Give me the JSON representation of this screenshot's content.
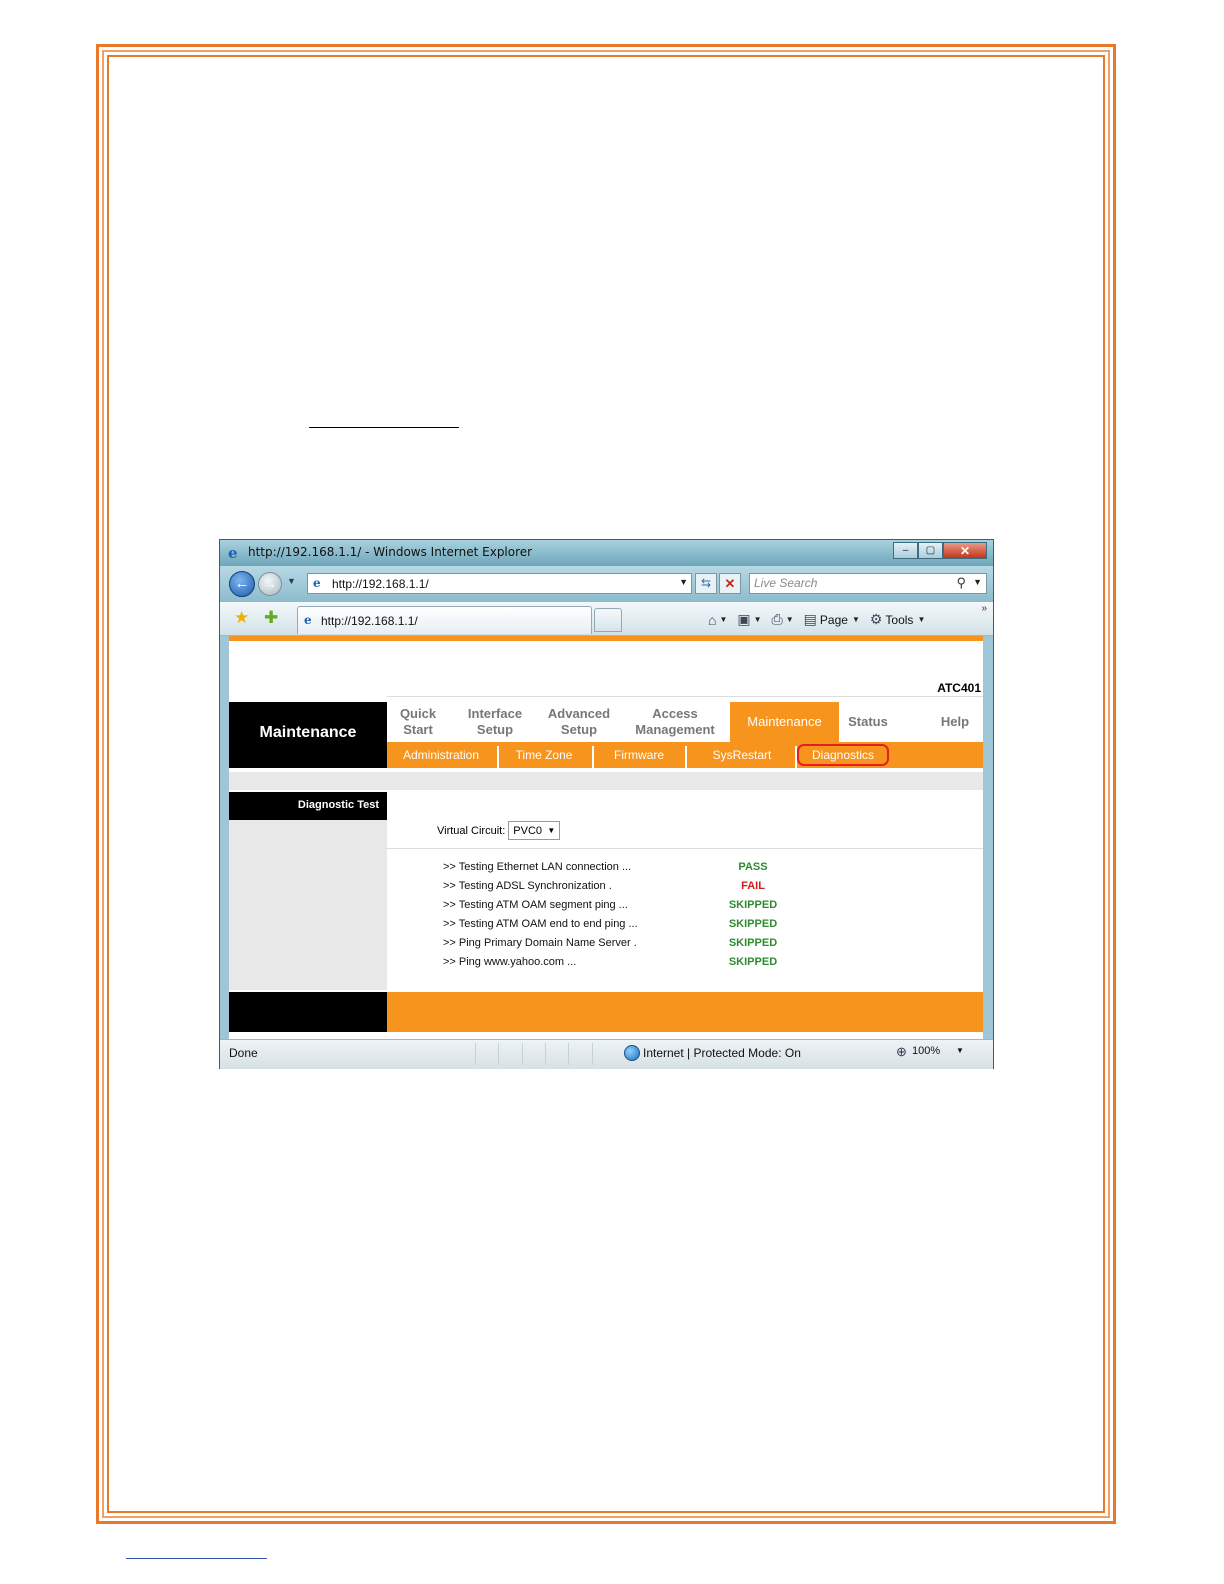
{
  "window": {
    "title": "http://192.168.1.1/ - Windows Internet Explorer",
    "minimize": "–",
    "maximize": "▢",
    "close": "✕"
  },
  "address_bar": {
    "url": "http://192.168.1.1/",
    "search_placeholder": "Live Search"
  },
  "tab": {
    "label": "http://192.168.1.1/"
  },
  "command_bar": {
    "page_label": "Page",
    "tools_label": "Tools"
  },
  "router": {
    "brand": "ATC401",
    "section_title": "Maintenance",
    "menu": [
      {
        "label": "Quick\nStart"
      },
      {
        "label": "Interface\nSetup"
      },
      {
        "label": "Advanced\nSetup"
      },
      {
        "label": "Access\nManagement"
      },
      {
        "label": "Maintenance",
        "active": true
      },
      {
        "label": "Status"
      },
      {
        "label": "Help"
      }
    ],
    "submenu": [
      {
        "label": "Administration"
      },
      {
        "label": "Time Zone"
      },
      {
        "label": "Firmware"
      },
      {
        "label": "SysRestart"
      },
      {
        "label": "Diagnostics",
        "selected": true
      }
    ],
    "sidebar_label": "Diagnostic Test",
    "virtual_circuit": {
      "label": "Virtual Circuit:",
      "value": "PVC0"
    },
    "tests": [
      {
        "label": ">> Testing Ethernet LAN connection ...",
        "result": "PASS"
      },
      {
        "label": ">> Testing ADSL Synchronization .",
        "result": "FAIL"
      },
      {
        "label": ">> Testing ATM OAM segment ping ...",
        "result": "SKIPPED"
      },
      {
        "label": ">> Testing ATM OAM end to end ping ...",
        "result": "SKIPPED"
      },
      {
        "label": ">> Ping Primary Domain Name Server .",
        "result": "SKIPPED"
      },
      {
        "label": ">> Ping www.yahoo.com ...",
        "result": "SKIPPED"
      }
    ]
  },
  "status_bar": {
    "status": "Done",
    "zone": "Internet | Protected Mode: On",
    "zoom": "100%"
  },
  "colors": {
    "accent_orange": "#f7941d",
    "border_orange": "#e8792b",
    "pass_green": "#2e8b2e",
    "fail_red": "#d41a1a"
  }
}
